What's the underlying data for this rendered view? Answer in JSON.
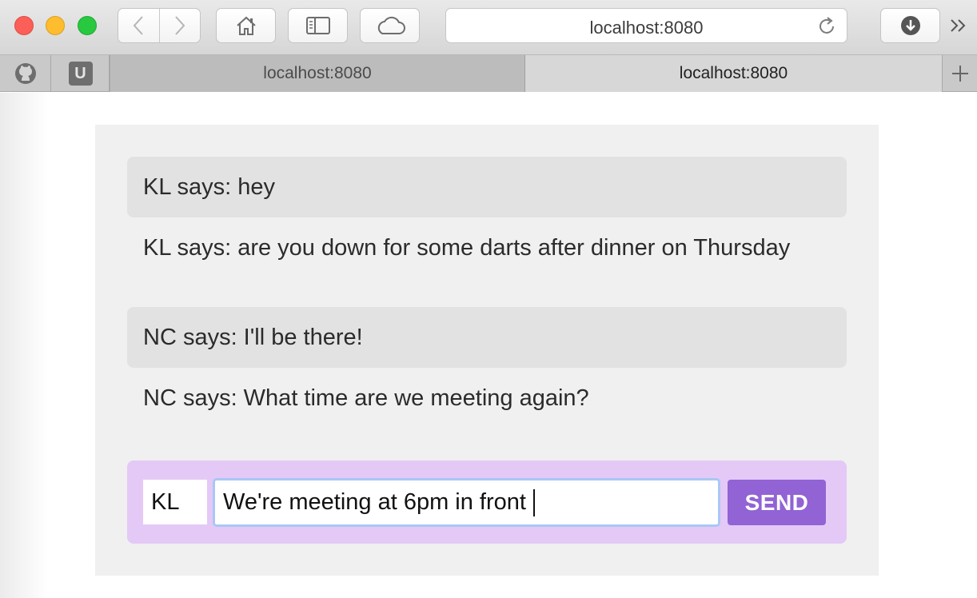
{
  "browser": {
    "address": "localhost:8080",
    "tabs": [
      {
        "title": "localhost:8080",
        "active": false
      },
      {
        "title": "localhost:8080",
        "active": true
      }
    ],
    "pinned_tabs": [
      "github-icon",
      "u-icon"
    ],
    "pinned_u_label": "U"
  },
  "chat": {
    "messages": [
      {
        "text": "KL says: hey",
        "shaded": true
      },
      {
        "text": "KL says: are you down for some darts after dinner on Thursday",
        "shaded": false
      },
      {
        "text": "NC says: I'll be there!",
        "shaded": true
      },
      {
        "text": "NC says: What time are we meeting again?",
        "shaded": false
      }
    ]
  },
  "composer": {
    "name_value": "KL",
    "message_value": "We're meeting at 6pm in front",
    "send_label": "SEND"
  },
  "colors": {
    "composer_bg": "#e4c9f6",
    "send_button": "#9163d4",
    "focus_ring": "#a9c7f5"
  }
}
